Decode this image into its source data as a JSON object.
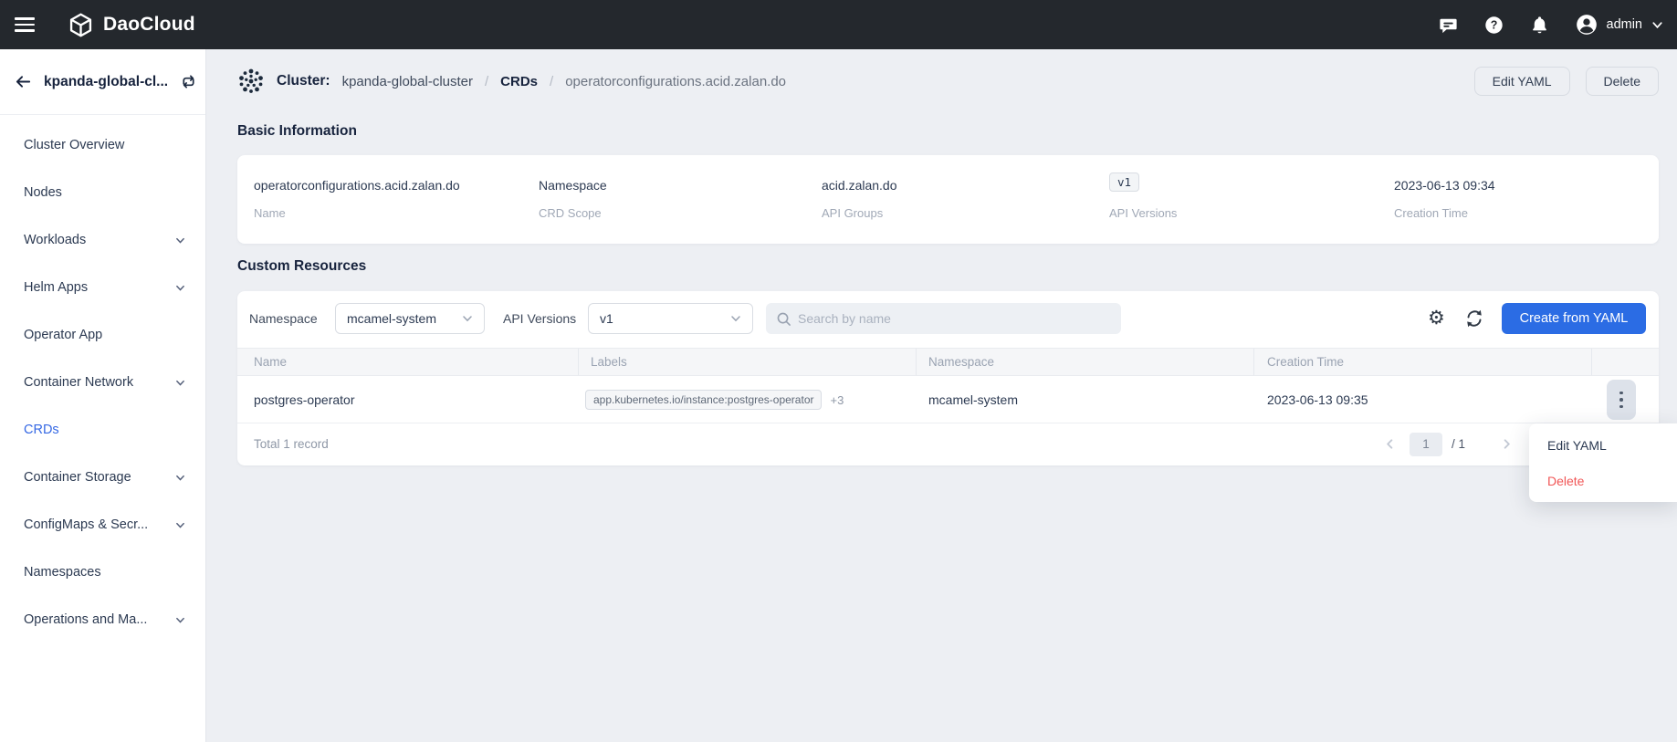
{
  "navbar": {
    "brand": "DaoCloud",
    "user": "admin"
  },
  "sidebar": {
    "cluster_name": "kpanda-global-cl...",
    "items": [
      {
        "label": "Cluster Overview",
        "expandable": false,
        "active": false
      },
      {
        "label": "Nodes",
        "expandable": false,
        "active": false
      },
      {
        "label": "Workloads",
        "expandable": true,
        "active": false
      },
      {
        "label": "Helm Apps",
        "expandable": true,
        "active": false
      },
      {
        "label": "Operator App",
        "expandable": false,
        "active": false
      },
      {
        "label": "Container Network",
        "expandable": true,
        "active": false
      },
      {
        "label": "CRDs",
        "expandable": false,
        "active": true
      },
      {
        "label": "Container Storage",
        "expandable": true,
        "active": false
      },
      {
        "label": "ConfigMaps & Secr...",
        "expandable": true,
        "active": false
      },
      {
        "label": "Namespaces",
        "expandable": false,
        "active": false
      },
      {
        "label": "Operations and Ma...",
        "expandable": true,
        "active": false
      }
    ]
  },
  "breadcrumb": {
    "prefix": "Cluster:",
    "separator": "/",
    "items": [
      "kpanda-global-cluster",
      "CRDs",
      "operatorconfigurations.acid.zalan.do"
    ]
  },
  "header_actions": {
    "edit_yaml": "Edit YAML",
    "delete": "Delete"
  },
  "basic_info": {
    "title": "Basic Information",
    "fields": [
      {
        "value": "operatorconfigurations.acid.zalan.do",
        "label": "Name"
      },
      {
        "value": "Namespace",
        "label": "CRD Scope"
      },
      {
        "value": "acid.zalan.do",
        "label": "API Groups"
      },
      {
        "value": "v1",
        "label": "API Versions"
      },
      {
        "value": "2023-06-13 09:34",
        "label": "Creation Time"
      }
    ]
  },
  "custom_resources": {
    "title": "Custom Resources",
    "filters": {
      "namespace_label": "Namespace",
      "namespace_value": "mcamel-system",
      "api_versions_label": "API Versions",
      "api_versions_value": "v1",
      "search_placeholder": "Search by name"
    },
    "toolbar": {
      "create_label": "Create from YAML"
    },
    "table": {
      "columns": [
        "Name",
        "Labels",
        "Namespace",
        "Creation Time"
      ],
      "rows": [
        {
          "name": "postgres-operator",
          "label_tag": "app.kubernetes.io/instance:postgres-operator",
          "label_more": "+3",
          "namespace": "mcamel-system",
          "creation_time": "2023-06-13 09:35"
        }
      ]
    },
    "footer": {
      "total": "Total 1 record",
      "page": "1",
      "page_total": "/ 1"
    }
  },
  "context_menu": {
    "items": [
      {
        "label": "Edit YAML",
        "danger": false
      },
      {
        "label": "Delete",
        "danger": true
      }
    ]
  },
  "icons": {
    "gear": "⚙"
  },
  "colors": {
    "accent": "#2b6ce4",
    "danger": "#f15656",
    "navbar_bg": "#24282d",
    "content_bg": "#edeff3",
    "active_link": "#3568e4"
  }
}
